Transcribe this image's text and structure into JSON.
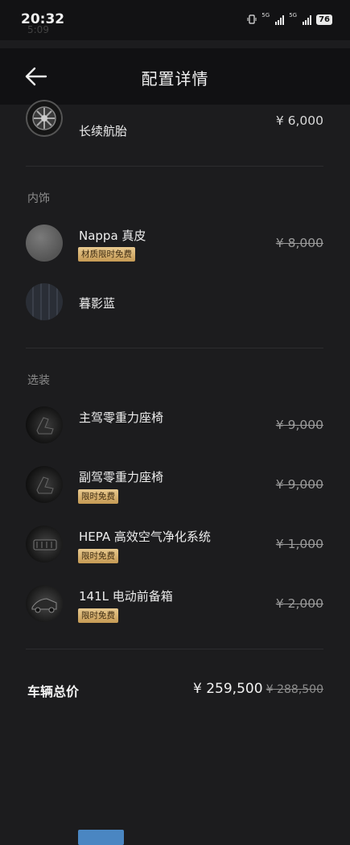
{
  "status_bar": {
    "time": "20:32",
    "sub": "5:09",
    "net1": "5G",
    "net2": "5G",
    "battery": "76"
  },
  "header": {
    "title": "配置详情"
  },
  "tire": {
    "name": "长续航胎",
    "price": "¥ 6,000"
  },
  "interior": {
    "section_label": "内饰",
    "items": [
      {
        "name": "Nappa 真皮",
        "badge": "材质限时免费",
        "price": "¥ 8,000"
      },
      {
        "name": "暮影蓝"
      }
    ]
  },
  "options": {
    "section_label": "选装",
    "items": [
      {
        "name": "主驾零重力座椅",
        "price": "¥ 9,000"
      },
      {
        "name": "副驾零重力座椅",
        "badge": "限时免费",
        "price": "¥ 9,000"
      },
      {
        "name": "HEPA 高效空气净化系统",
        "badge": "限时免费",
        "price": "¥ 1,000"
      },
      {
        "name": "141L 电动前备箱",
        "badge": "限时免费",
        "price": "¥ 2,000"
      }
    ]
  },
  "footer": {
    "label": "车辆总价",
    "price": "¥ 259,500",
    "original_price": "¥ 288,500"
  },
  "colors": {
    "badge_gold": "#d9b775",
    "highlight_blue": "#4a86c2",
    "background": "#1c1c1e"
  }
}
